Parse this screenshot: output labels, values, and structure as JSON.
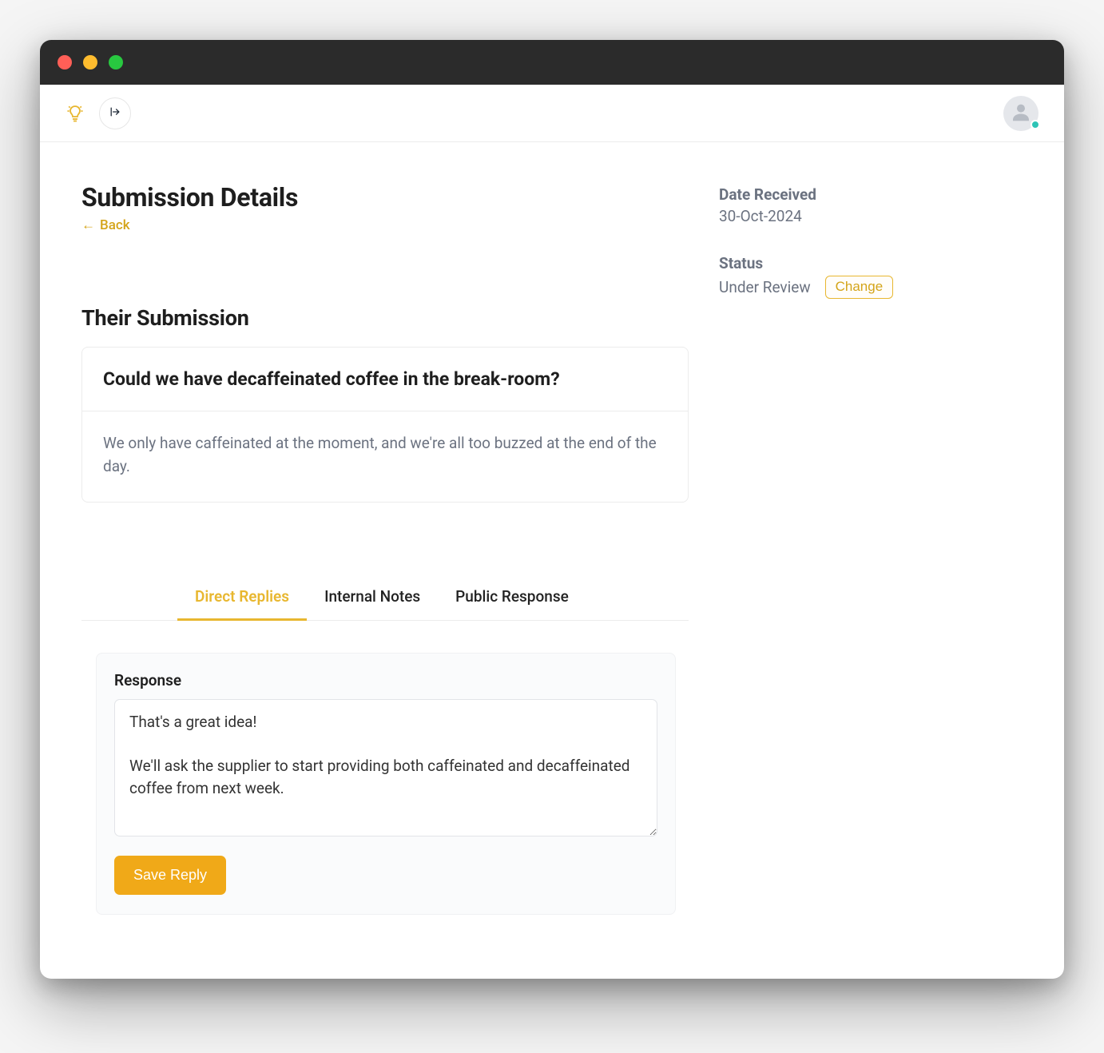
{
  "window": {
    "traffic": {
      "red": true,
      "yellow": true,
      "green": true
    }
  },
  "icons": {
    "logo": "lightbulb-icon",
    "sidebar_toggle": "sidebar-expand-icon",
    "avatar": "avatar-placeholder-icon"
  },
  "header": {
    "page_title": "Submission Details",
    "back_label": "Back",
    "back_arrow": "←"
  },
  "side_meta": {
    "date_label": "Date Received",
    "date_value": "30-Oct-2024",
    "status_label": "Status",
    "status_value": "Under Review",
    "change_label": "Change"
  },
  "submission": {
    "heading": "Their Submission",
    "title": "Could we have decaffeinated coffee in the break-room?",
    "body": "We only have caffeinated at the moment, and we're all too buzzed at the end of the day."
  },
  "tabs": [
    {
      "id": "direct-replies",
      "label": "Direct Replies",
      "active": true
    },
    {
      "id": "internal-notes",
      "label": "Internal Notes",
      "active": false
    },
    {
      "id": "public-response",
      "label": "Public Response",
      "active": false
    }
  ],
  "response": {
    "label": "Response",
    "value": "That's a great idea!\n\nWe'll ask the supplier to start providing both caffeinated and decaffeinated coffee from next week.",
    "save_label": "Save Reply"
  }
}
